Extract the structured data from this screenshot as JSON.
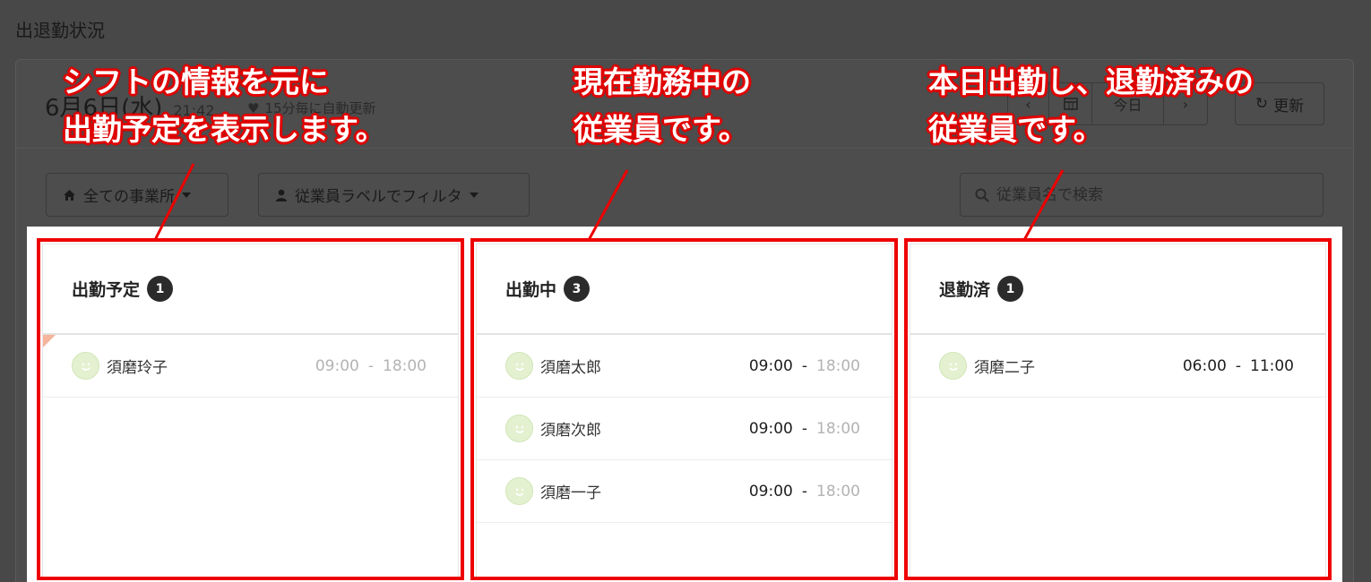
{
  "page": {
    "title": "出退勤状況"
  },
  "header": {
    "date": "6月6日(水)",
    "time": "21:42",
    "auto_refresh": "15分毎に自動更新",
    "nav": {
      "prev": "‹",
      "calendar_icon": "calendar-icon",
      "today": "今日",
      "next": "›"
    },
    "refresh_label": "更新"
  },
  "filters": {
    "office_label": "全ての事業所",
    "label_filter": "従業員ラベルでフィルタ",
    "search_placeholder": "従業員名で検索"
  },
  "columns": [
    {
      "title": "出勤予定",
      "count": "1",
      "rows": [
        {
          "name": "須磨玲子",
          "start": "09:00",
          "sep": "-",
          "end": "18:00"
        }
      ]
    },
    {
      "title": "出勤中",
      "count": "3",
      "rows": [
        {
          "name": "須磨太郎",
          "start": "09:00",
          "sep": "-",
          "end": "18:00"
        },
        {
          "name": "須磨次郎",
          "start": "09:00",
          "sep": "-",
          "end": "18:00"
        },
        {
          "name": "須磨一子",
          "start": "09:00",
          "sep": "-",
          "end": "18:00"
        }
      ]
    },
    {
      "title": "退勤済",
      "count": "1",
      "rows": [
        {
          "name": "須磨二子",
          "start": "06:00",
          "sep": "-",
          "end": "11:00"
        }
      ]
    }
  ],
  "annotations": [
    {
      "line1": "シフトの情報を元に",
      "line2": "出勤予定を表示します。"
    },
    {
      "line1": "現在勤務中の",
      "line2": "従業員です。"
    },
    {
      "line1": "本日出勤し、退勤済みの",
      "line2": "従業員です。"
    }
  ],
  "colors": {
    "highlight": "#ee0000",
    "badge": "#2b2b2b",
    "overlay": "#484848"
  }
}
